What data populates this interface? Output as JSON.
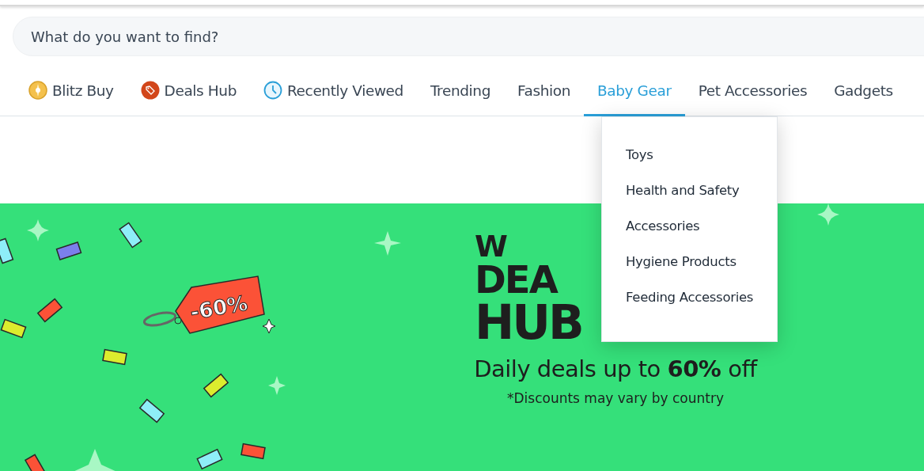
{
  "search": {
    "placeholder": "What do you want to find?"
  },
  "nav": [
    {
      "label": "Blitz Buy",
      "kind": "coin",
      "selected": false
    },
    {
      "label": "Deals Hub",
      "kind": "tag",
      "selected": false
    },
    {
      "label": "Recently Viewed",
      "kind": "clock",
      "selected": false
    },
    {
      "label": "Trending",
      "kind": "plain",
      "selected": false
    },
    {
      "label": "Fashion",
      "kind": "plain",
      "selected": false
    },
    {
      "label": "Baby Gear",
      "kind": "plain",
      "selected": true
    },
    {
      "label": "Pet Accessories",
      "kind": "plain",
      "selected": false
    },
    {
      "label": "Gadgets",
      "kind": "plain",
      "selected": false
    }
  ],
  "dropdown": {
    "items": [
      "Toys",
      "Health and Safety",
      "Accessories",
      "Hygiene Products",
      "Feeding Accessories"
    ]
  },
  "banner": {
    "tag": "-60%",
    "title": [
      "W",
      "DEA",
      "HUB"
    ],
    "headline": "Daily deals up to **60%** off",
    "note": "*Discounts may vary by country"
  }
}
